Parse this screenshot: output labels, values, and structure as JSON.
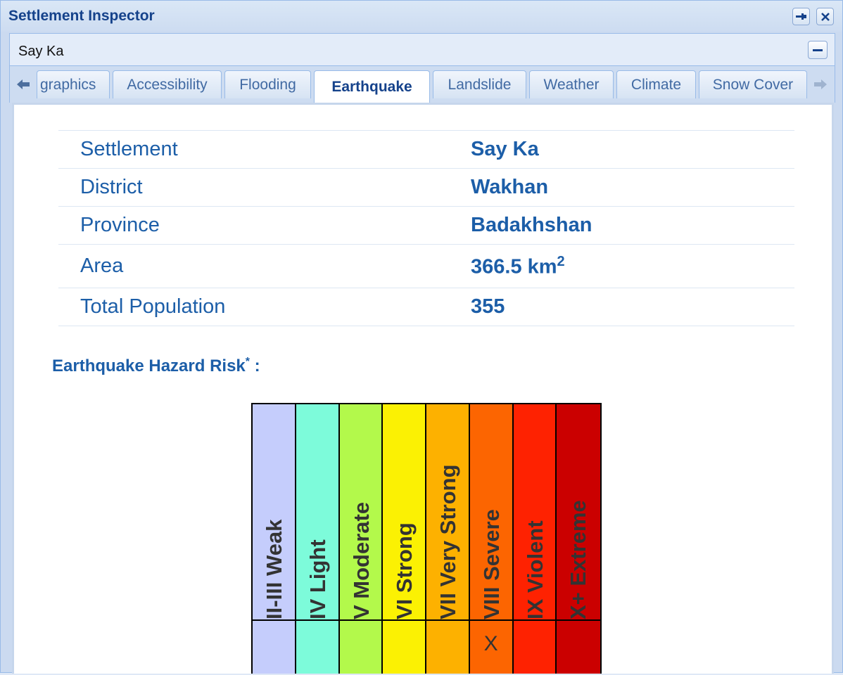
{
  "window": {
    "title": "Settlement Inspector",
    "subtitle": "Say Ka",
    "pin_icon": "pin-icon",
    "close_icon": "close-icon",
    "collapse_icon": "minus-icon"
  },
  "tabs": {
    "items": [
      {
        "label": "graphics",
        "active": false
      },
      {
        "label": "Accessibility",
        "active": false
      },
      {
        "label": "Flooding",
        "active": false
      },
      {
        "label": "Earthquake",
        "active": true
      },
      {
        "label": "Landslide",
        "active": false
      },
      {
        "label": "Weather",
        "active": false
      },
      {
        "label": "Climate",
        "active": false
      },
      {
        "label": "Snow Cover",
        "active": false
      }
    ],
    "scroll_left_icon": "arrow-left-icon",
    "scroll_right_icon": "arrow-right-icon"
  },
  "info": {
    "rows": [
      {
        "label": "Settlement",
        "value": "Say Ka"
      },
      {
        "label": "District",
        "value": "Wakhan"
      },
      {
        "label": "Province",
        "value": "Badakhshan"
      },
      {
        "label": "Area",
        "value": "366.5 km",
        "sup": "2"
      },
      {
        "label": "Total Population",
        "value": "355"
      }
    ]
  },
  "hazard": {
    "heading": "Earthquake Hazard Risk",
    "heading_star": "*",
    "heading_suffix": " :",
    "levels": [
      {
        "label": "II-III Weak",
        "color": "#c5cdfc",
        "mark": ""
      },
      {
        "label": "IV Light",
        "color": "#7dfbda",
        "mark": ""
      },
      {
        "label": "V Moderate",
        "color": "#b3f94b",
        "mark": ""
      },
      {
        "label": "VI Strong",
        "color": "#fbf103",
        "mark": ""
      },
      {
        "label": "VII Very Strong",
        "color": "#fdb100",
        "mark": ""
      },
      {
        "label": "VIII Severe",
        "color": "#fc6501",
        "mark": "X"
      },
      {
        "label": "IX Violent",
        "color": "#fe2201",
        "mark": ""
      },
      {
        "label": "X+ Extreme",
        "color": "#cb0000",
        "mark": ""
      }
    ]
  }
}
